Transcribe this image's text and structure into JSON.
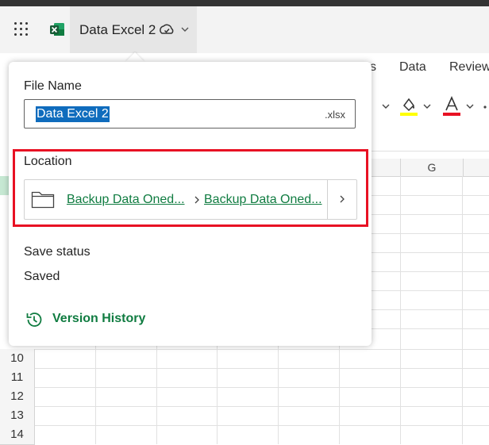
{
  "app": {
    "document_title": "Data Excel 2",
    "icons": {
      "launcher": "app-launcher-icon",
      "logo": "excel-logo-icon",
      "sync": "sync-status-icon",
      "dropdown": "chevron-down-icon"
    },
    "brand_color": "#107c41"
  },
  "ribbon": {
    "tabs": [
      {
        "label": "s"
      },
      {
        "label": "Data"
      },
      {
        "label": "Review"
      }
    ],
    "commands": {
      "fill_color": "#ffff00",
      "font_color": "#e81123"
    }
  },
  "sheet": {
    "visible_column": "G",
    "rows": [
      "10",
      "11",
      "12",
      "13",
      "14"
    ]
  },
  "file_panel": {
    "file_name_label": "File Name",
    "file_name_value": "Data Excel 2",
    "extension": ".xlsx",
    "location_label": "Location",
    "location_crumbs": [
      "Backup Data Oned...",
      "Backup Data Oned..."
    ],
    "save_status_label": "Save status",
    "save_status_value": "Saved",
    "version_history_label": "Version History",
    "highlight_color": "#e81123"
  }
}
